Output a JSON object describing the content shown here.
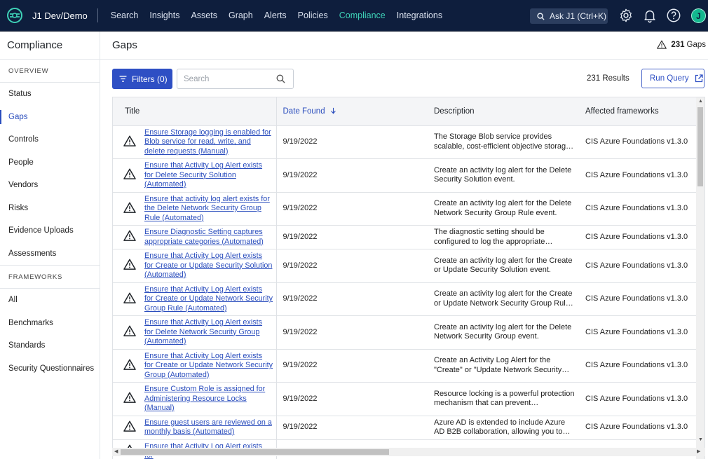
{
  "app": {
    "name": "J1 Dev/Demo"
  },
  "topnav": [
    "Search",
    "Insights",
    "Assets",
    "Graph",
    "Alerts",
    "Policies",
    "Compliance",
    "Integrations"
  ],
  "topnav_active": "Compliance",
  "ask_button": "Ask J1 (Ctrl+K)",
  "avatar_initial": "J",
  "colors": {
    "topbar": "#0e1e3d",
    "accent": "#3ed1b7",
    "primary": "#2e4fc4",
    "link": "#2a4dbd"
  },
  "sidebar": {
    "title": "Compliance",
    "overview_label": "OVERVIEW",
    "overview_items": [
      "Status",
      "Gaps",
      "Controls",
      "People",
      "Vendors",
      "Risks",
      "Evidence Uploads",
      "Assessments"
    ],
    "active_item": "Gaps",
    "frameworks_label": "FRAMEWORKS",
    "framework_items": [
      "All",
      "Benchmarks",
      "Standards",
      "Security Questionnaires"
    ]
  },
  "main": {
    "title": "Gaps",
    "gap_count": "231",
    "gap_label": "Gaps",
    "filters_label": "Filters (0)",
    "search_placeholder": "Search",
    "results_text": "231 Results",
    "run_query_label": "Run Query"
  },
  "table": {
    "headers": {
      "title": "Title",
      "date": "Date Found",
      "description": "Description",
      "frameworks": "Affected frameworks"
    },
    "rows": [
      {
        "title": "Ensure Storage logging is enabled for Blob service for read, write, and delete requests (Manual)",
        "date": "9/19/2022",
        "description": "The Storage Blob service provides scalable, cost-efficient objective storage in the clou...",
        "framework": "CIS Azure Foundations v1.3.0"
      },
      {
        "title": "Ensure that Activity Log Alert exists for Delete Security Solution (Automated)",
        "date": "9/19/2022",
        "description": "Create an activity log alert for the Delete Security Solution event.",
        "framework": "CIS Azure Foundations v1.3.0"
      },
      {
        "title": "Ensure that activity log alert exists for the Delete Network Security Group Rule (Automated)",
        "date": "9/19/2022",
        "description": "Create an activity log alert for the Delete Network Security Group Rule event.",
        "framework": "CIS Azure Foundations v1.3.0"
      },
      {
        "title": "Ensure Diagnostic Setting captures appropriate categories (Automated)",
        "date": "9/19/2022",
        "description": "The diagnostic setting should be configured to log the appropriate activities from the...",
        "framework": "CIS Azure Foundations v1.3.0"
      },
      {
        "title": "Ensure that Activity Log Alert exists for Create or Update Security Solution (Automated)",
        "date": "9/19/2022",
        "description": "Create an activity log alert for the Create or Update Security Solution event.",
        "framework": "CIS Azure Foundations v1.3.0"
      },
      {
        "title": "Ensure that Activity Log Alert exists for Create or Update Network Security Group Rule (Automated)",
        "date": "9/19/2022",
        "description": "Create an activity log alert for the Create or Update Network Security Group Rule event.",
        "framework": "CIS Azure Foundations v1.3.0"
      },
      {
        "title": "Ensure that Activity Log Alert exists for Delete Network Security Group (Automated)",
        "date": "9/19/2022",
        "description": "Create an activity log alert for the Delete Network Security Group event.",
        "framework": "CIS Azure Foundations v1.3.0"
      },
      {
        "title": "Ensure that Activity Log Alert exists for Create or Update Network Security Group (Automated)",
        "date": "9/19/2022",
        "description": "Create an Activity Log Alert for the \"Create\" or \"Update Network Security Group\" event.",
        "framework": "CIS Azure Foundations v1.3.0"
      },
      {
        "title": "Ensure Custom Role is assigned for Administering Resource Locks (Manual)",
        "date": "9/19/2022",
        "description": "Resource locking is a powerful protection mechanism that can prevent inadvertent...",
        "framework": "CIS Azure Foundations v1.3.0"
      },
      {
        "title": "Ensure guest users are reviewed on a monthly basis (Automated)",
        "date": "9/19/2022",
        "description": "Azure AD is extended to include Azure AD B2B collaboration, allowing you to invite...",
        "framework": "CIS Azure Foundations v1.3.0"
      },
      {
        "title": "Ensure that Activity Log Alert exists for",
        "date": "",
        "description": "",
        "framework": ""
      }
    ]
  }
}
